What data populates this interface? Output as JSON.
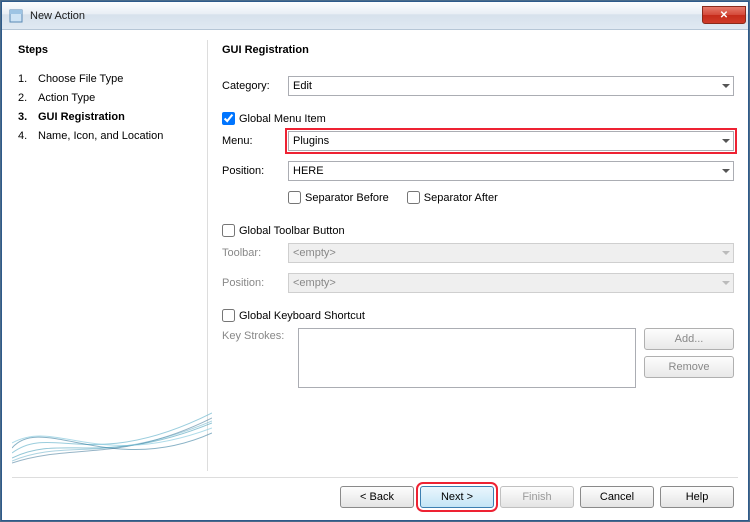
{
  "window": {
    "title": "New Action"
  },
  "steps": {
    "heading": "Steps",
    "items": [
      {
        "num": "1.",
        "label": "Choose File Type"
      },
      {
        "num": "2.",
        "label": "Action Type"
      },
      {
        "num": "3.",
        "label": "GUI Registration"
      },
      {
        "num": "4.",
        "label": "Name, Icon, and Location"
      }
    ],
    "currentIndex": 2
  },
  "main": {
    "heading": "GUI Registration",
    "category": {
      "label": "Category:",
      "value": "Edit"
    },
    "globalMenu": {
      "checkboxLabel": "Global Menu Item",
      "checked": true,
      "menuLabel": "Menu:",
      "menuValue": "Plugins",
      "positionLabel": "Position:",
      "positionValue": "HERE",
      "sepBefore": "Separator Before",
      "sepAfter": "Separator After"
    },
    "globalToolbar": {
      "checkboxLabel": "Global Toolbar Button",
      "checked": false,
      "toolbarLabel": "Toolbar:",
      "toolbarValue": "<empty>",
      "positionLabel": "Position:",
      "positionValue": "<empty>"
    },
    "globalShortcut": {
      "checkboxLabel": "Global Keyboard Shortcut",
      "checked": false,
      "keystrokesLabel": "Key Strokes:",
      "addBtn": "Add...",
      "removeBtn": "Remove"
    }
  },
  "footer": {
    "back": "< Back",
    "next": "Next >",
    "finish": "Finish",
    "cancel": "Cancel",
    "help": "Help"
  }
}
